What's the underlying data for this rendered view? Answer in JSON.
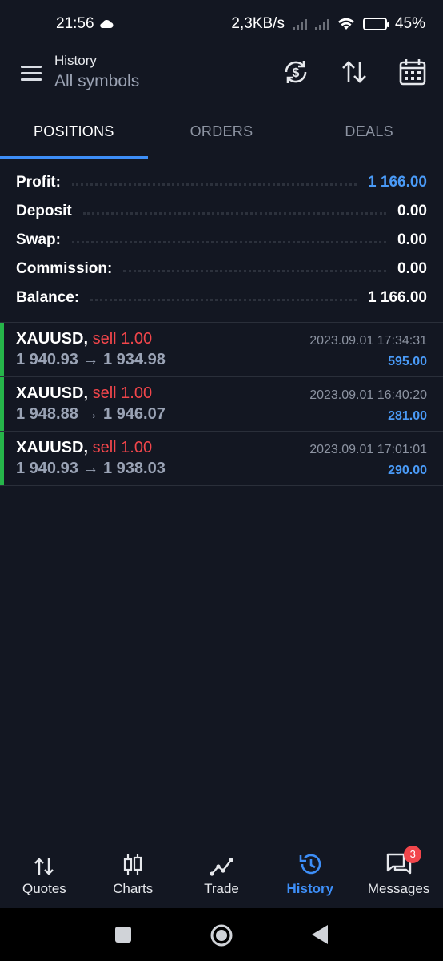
{
  "status": {
    "time": "21:56",
    "speed": "2,3KB/s",
    "battery": "45%",
    "battery_level": 0.45
  },
  "header": {
    "title": "History",
    "subtitle": "All symbols",
    "icons": [
      "menu-icon",
      "currency-exchange-icon",
      "sort-icon",
      "calendar-icon"
    ]
  },
  "tabs": [
    {
      "label": "POSITIONS",
      "active": true
    },
    {
      "label": "ORDERS",
      "active": false
    },
    {
      "label": "DEALS",
      "active": false
    }
  ],
  "summary": [
    {
      "label": "Profit:",
      "value": "1 166.00"
    },
    {
      "label": "Deposit",
      "value": "0.00"
    },
    {
      "label": "Swap:",
      "value": "0.00"
    },
    {
      "label": "Commission:",
      "value": "0.00"
    },
    {
      "label": "Balance:",
      "value": "1 166.00"
    }
  ],
  "positions": [
    {
      "symbol": "XAUUSD,",
      "side": "sell 1.00",
      "prices": "1 940.93 → 1 934.98",
      "datetime": "2023.09.01 17:34:31",
      "profit": "595.00"
    },
    {
      "symbol": "XAUUSD,",
      "side": "sell 1.00",
      "prices": "1 948.88 → 1 946.07",
      "datetime": "2023.09.01 16:40:20",
      "profit": "281.00"
    },
    {
      "symbol": "XAUUSD,",
      "side": "sell 1.00",
      "prices": "1 940.93 → 1 938.03",
      "datetime": "2023.09.01 17:01:01",
      "profit": "290.00"
    }
  ],
  "bottom_nav": [
    {
      "label": "Quotes",
      "icon": "quotes-icon",
      "active": false
    },
    {
      "label": "Charts",
      "icon": "candles-icon",
      "active": false
    },
    {
      "label": "Trade",
      "icon": "trade-icon",
      "active": false
    },
    {
      "label": "History",
      "icon": "history-icon",
      "active": true
    },
    {
      "label": "Messages",
      "icon": "messages-icon",
      "active": false,
      "badge": "3"
    }
  ],
  "colors": {
    "background": "#131722",
    "accent": "#3d8ef7",
    "sell": "#f2464b",
    "profit": "#4a9bf8",
    "position_bar": "#26b54a"
  }
}
